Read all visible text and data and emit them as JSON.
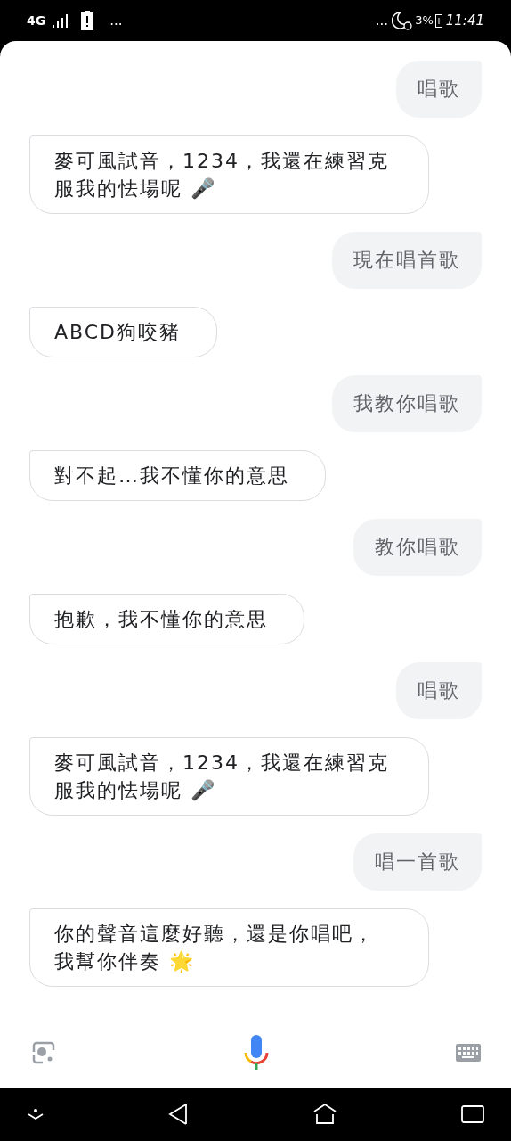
{
  "status_bar": {
    "network": "4G",
    "left_more": "...",
    "right_more": "...",
    "battery": "3%",
    "time": "11:41"
  },
  "messages": [
    {
      "kind": "user",
      "text": "唱歌"
    },
    {
      "kind": "assistant",
      "text": "麥可風試音，1234，我還在練習克服我的怯場呢 🎤"
    },
    {
      "kind": "user",
      "text": "現在唱首歌"
    },
    {
      "kind": "assistant",
      "text": "ABCD狗咬豬"
    },
    {
      "kind": "user",
      "text": "我教你唱歌"
    },
    {
      "kind": "assistant",
      "text": "對不起…我不懂你的意思"
    },
    {
      "kind": "user",
      "text": "教你唱歌"
    },
    {
      "kind": "assistant",
      "text": "抱歉，我不懂你的意思"
    },
    {
      "kind": "user",
      "text": "唱歌"
    },
    {
      "kind": "assistant",
      "text": "麥可風試音，1234，我還在練習克服我的怯場呢 🎤"
    },
    {
      "kind": "user",
      "text": "唱一首歌"
    },
    {
      "kind": "assistant",
      "text": "你的聲音這麼好聽，還是你唱吧，我幫你伴奏 🌟"
    }
  ]
}
